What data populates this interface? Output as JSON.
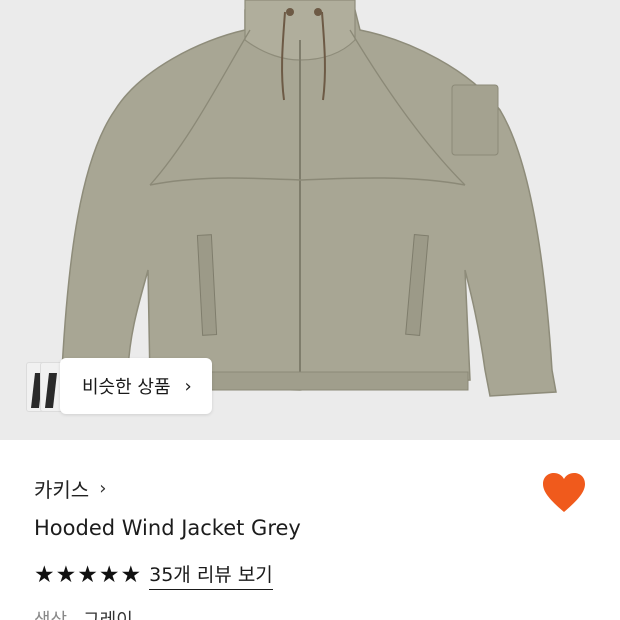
{
  "similar_button": {
    "label": "비슷한 상품",
    "chevron": "›"
  },
  "product": {
    "brand": "카키스",
    "brand_chevron": "›",
    "name": "Hooded Wind Jacket Grey",
    "rating": {
      "stars": 5,
      "star_glyph": "★",
      "review_text": "35개 리뷰 보기"
    },
    "color_label": "색상",
    "color_value": "그레이"
  },
  "icons": {
    "wishlist": "heart-icon",
    "wishlist_color": "#f05a1c"
  },
  "colors": {
    "hero_bg": "#ebebeb",
    "jacket": "#a8a694"
  }
}
